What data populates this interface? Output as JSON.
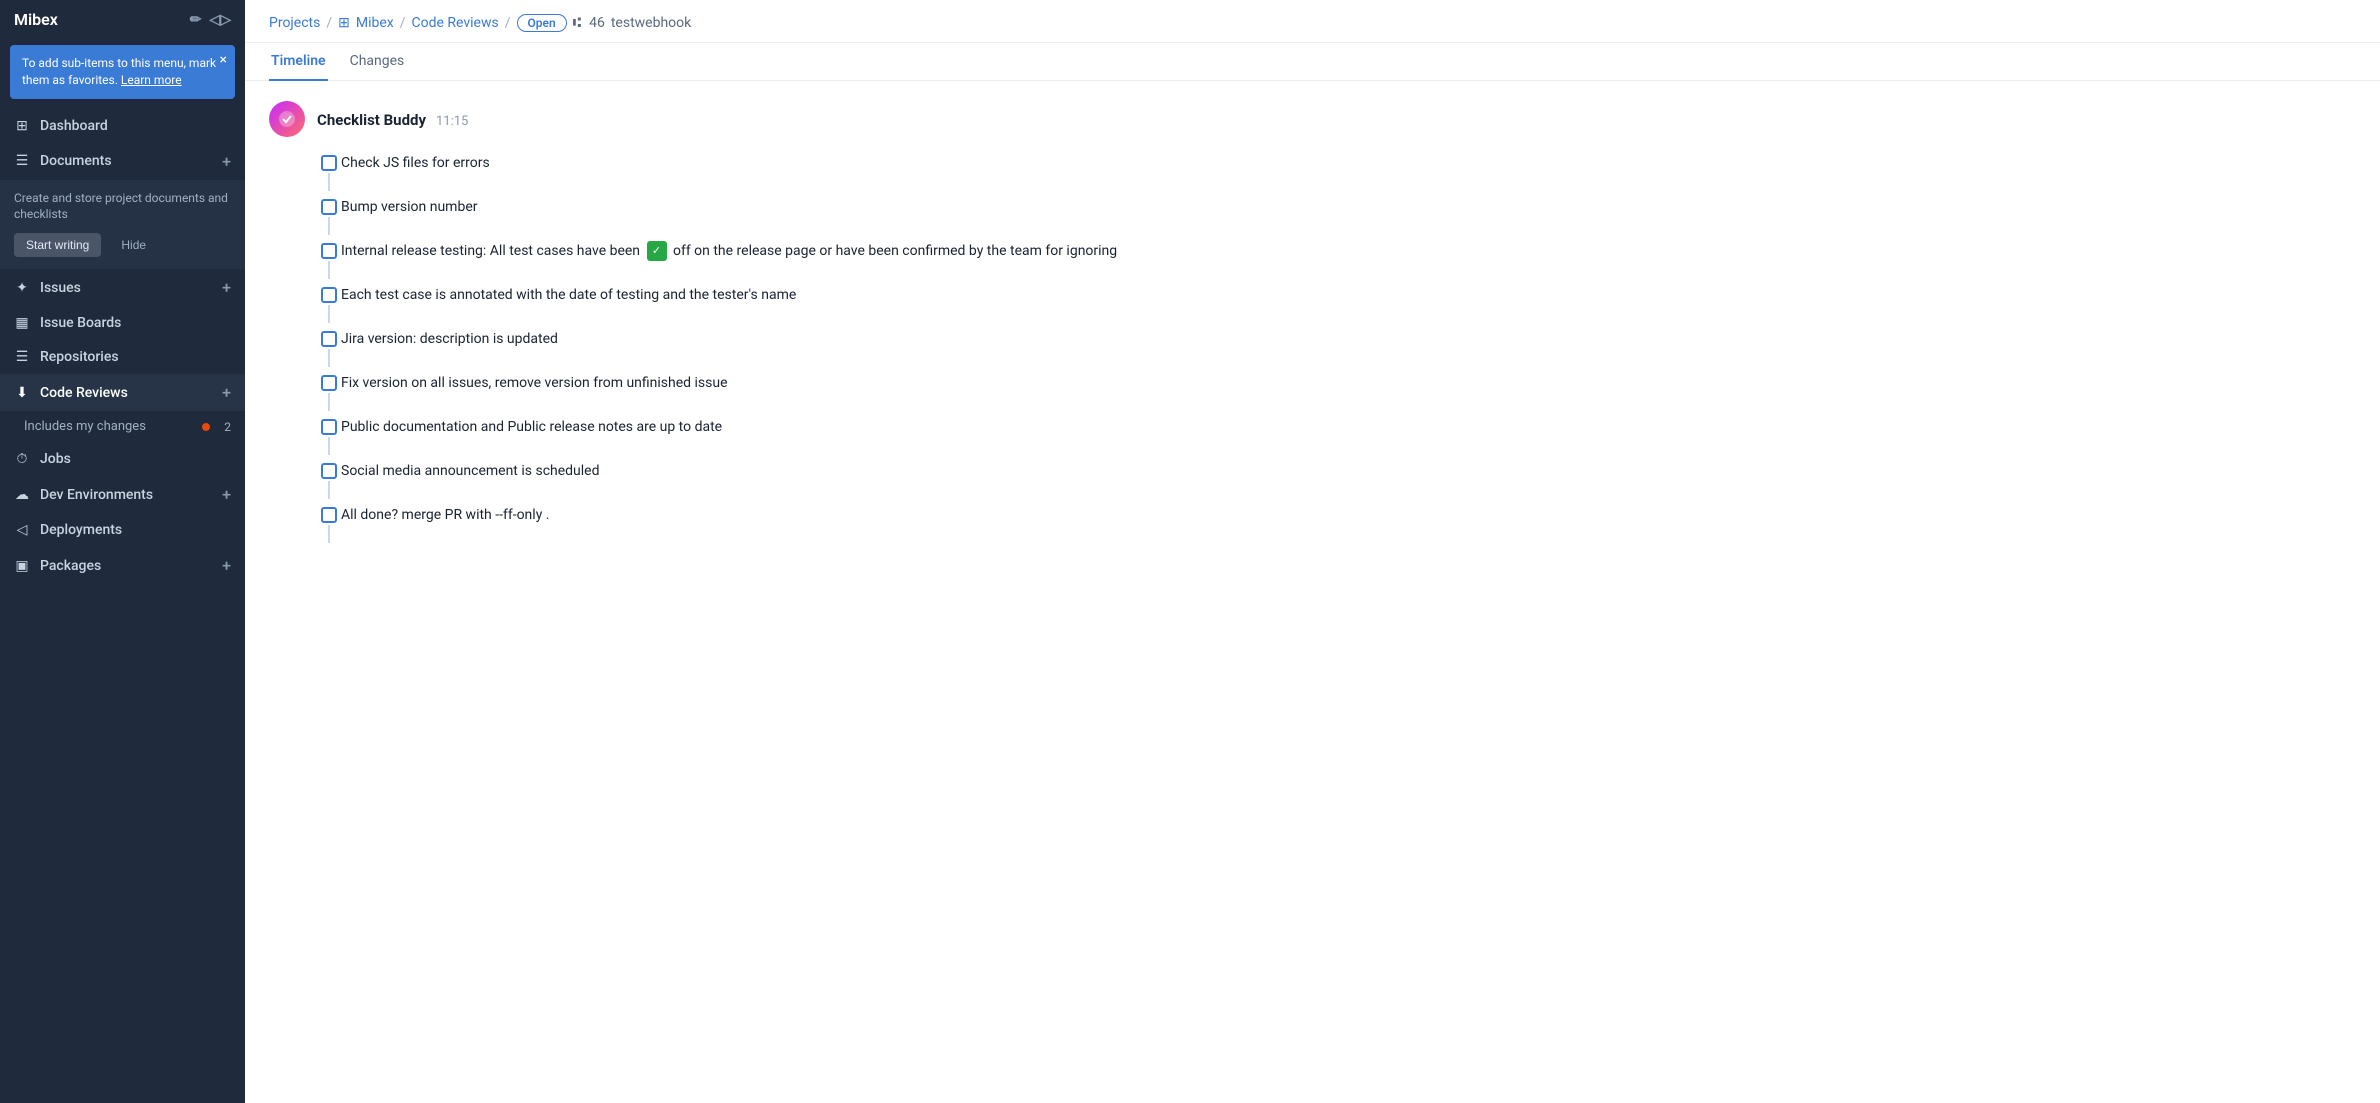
{
  "sidebar": {
    "title": "Mibex",
    "banner": {
      "text": "To add sub-items to this menu, mark them as favorites.",
      "link_text": "Learn more",
      "close_label": "×"
    },
    "nav_items": [
      {
        "id": "dashboard",
        "icon": "⊞",
        "label": "Dashboard",
        "has_plus": false
      },
      {
        "id": "documents",
        "icon": "☰",
        "label": "Documents",
        "has_plus": true
      },
      {
        "id": "issues",
        "icon": "✦",
        "label": "Issues",
        "has_plus": true
      },
      {
        "id": "issue-boards",
        "icon": "▦",
        "label": "Issue Boards",
        "has_plus": false
      },
      {
        "id": "repositories",
        "icon": "☰",
        "label": "Repositories",
        "has_plus": false
      },
      {
        "id": "code-reviews",
        "icon": "⬇",
        "label": "Code Reviews",
        "has_plus": true
      },
      {
        "id": "jobs",
        "icon": "⏱",
        "label": "Jobs",
        "has_plus": false
      },
      {
        "id": "dev-environments",
        "icon": "☁",
        "label": "Dev Environments",
        "has_plus": true
      },
      {
        "id": "deployments",
        "icon": "◁",
        "label": "Deployments",
        "has_plus": false
      },
      {
        "id": "packages",
        "icon": "▣",
        "label": "Packages",
        "has_plus": true
      }
    ],
    "documents_section": {
      "desc": "Create and store project documents and checklists",
      "start_writing": "Start writing",
      "hide": "Hide"
    },
    "sub_items": {
      "includes_my_changes": {
        "label": "Includes my changes",
        "count": "2"
      }
    }
  },
  "breadcrumb": {
    "projects": "Projects",
    "sep1": "/",
    "mibex": "Mibex",
    "sep2": "/",
    "code_reviews": "Code Reviews",
    "sep3": "/",
    "open_badge": "Open",
    "pr_number": "46",
    "pr_title": "testwebhook"
  },
  "tabs": [
    {
      "id": "timeline",
      "label": "Timeline",
      "active": true
    },
    {
      "id": "changes",
      "label": "Changes",
      "active": false
    }
  ],
  "checklist": {
    "author": "Checklist Buddy",
    "time": "11:15",
    "items": [
      {
        "id": 1,
        "text": "Check JS files for errors",
        "checked": false
      },
      {
        "id": 2,
        "text": "Bump version number",
        "checked": false
      },
      {
        "id": 3,
        "text": "Internal release testing: All test cases have been ✓ off on the release page or have been confirmed by the team for ignoring",
        "checked": false,
        "has_check_emoji": true
      },
      {
        "id": 4,
        "text": "Each test case is annotated with the date of testing and the tester's name",
        "checked": false
      },
      {
        "id": 5,
        "text": "Jira version: description is updated",
        "checked": false
      },
      {
        "id": 6,
        "text": "Fix version on all issues, remove version from unfinished issue",
        "checked": false
      },
      {
        "id": 7,
        "text": "Public documentation and Public release notes are up to date",
        "checked": false
      },
      {
        "id": 8,
        "text": "Social media announcement is scheduled",
        "checked": false
      },
      {
        "id": 9,
        "text": "All done? merge PR with --ff-only .",
        "checked": false
      }
    ]
  }
}
